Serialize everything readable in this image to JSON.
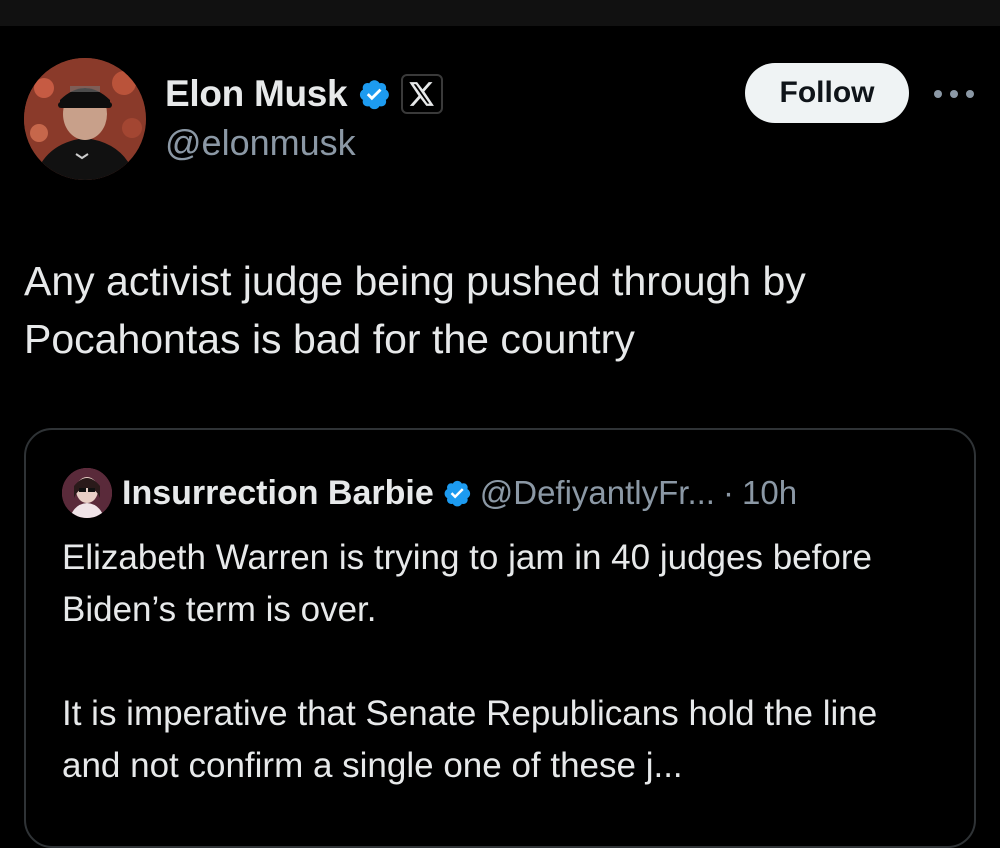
{
  "author": {
    "display_name": "Elon Musk",
    "handle": "@elonmusk",
    "verified_icon": "verified-badge-icon",
    "affiliation_icon": "x-logo-icon"
  },
  "actions": {
    "follow_label": "Follow",
    "more_icon": "more-horizontal-icon"
  },
  "tweet": {
    "text": "Any activist judge being pushed through by\nPocahontas is bad for the country"
  },
  "quoted_tweet": {
    "display_name": "Insurrection Barbie",
    "handle": "@DefiyantlyFr...",
    "separator": "·",
    "time": "10h",
    "paragraph_1": "Elizabeth Warren is trying to jam in 40 judges before Biden’s term is over.",
    "paragraph_2": "It is imperative that Senate Republicans hold the line and not confirm a single one of these j..."
  },
  "colors": {
    "background": "#000000",
    "text_primary": "#e7e9ea",
    "text_secondary": "#8b98a5",
    "verified_blue": "#1d9bf0",
    "border": "#2f3336",
    "follow_bg": "#eff3f4"
  }
}
